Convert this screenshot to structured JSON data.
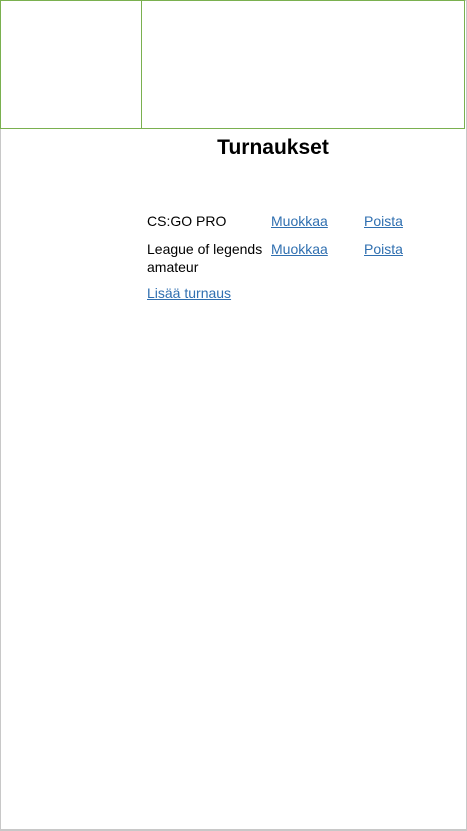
{
  "page": {
    "title": "Turnaukset"
  },
  "tournaments": [
    {
      "name": "CS:GO PRO",
      "edit_label": "Muokkaa",
      "delete_label": "Poista"
    },
    {
      "name": "League of legends amateur",
      "edit_label": "Muokkaa",
      "delete_label": "Poista"
    }
  ],
  "actions": {
    "add_label": "Lisää turnaus"
  },
  "colors": {
    "link": "#2f6fb0",
    "header_border": "#7ab04f",
    "frame_border": "#c8c8c8"
  }
}
